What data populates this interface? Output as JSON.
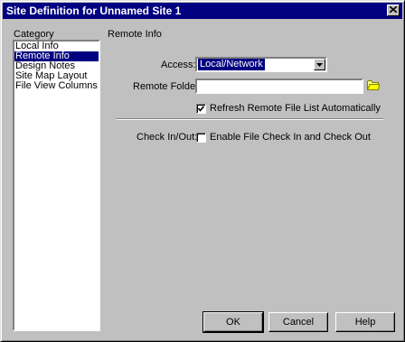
{
  "window": {
    "title": "Site Definition for Unnamed Site 1"
  },
  "sidebar": {
    "heading": "Category",
    "items": [
      "Local Info",
      "Remote Info",
      "Design Notes",
      "Site Map Layout",
      "File View Columns"
    ],
    "selected": "Remote Info"
  },
  "panel": {
    "heading": "Remote Info",
    "access_label": "Access:",
    "access_value": "Local/Network",
    "remote_folder_label": "Remote Folder:",
    "remote_folder_value": "",
    "refresh_label": "Refresh Remote File List Automatically",
    "refresh_checked": true,
    "checkinout_label": "Check In/Out:",
    "checkinout_option_label": "Enable File Check In and Check Out",
    "checkinout_checked": false
  },
  "buttons": {
    "ok": "OK",
    "cancel": "Cancel",
    "help": "Help"
  },
  "icons": {
    "close": "close-icon",
    "folder": "folder-icon",
    "dropdown": "chevron-down-icon",
    "check": "checkmark-icon"
  }
}
